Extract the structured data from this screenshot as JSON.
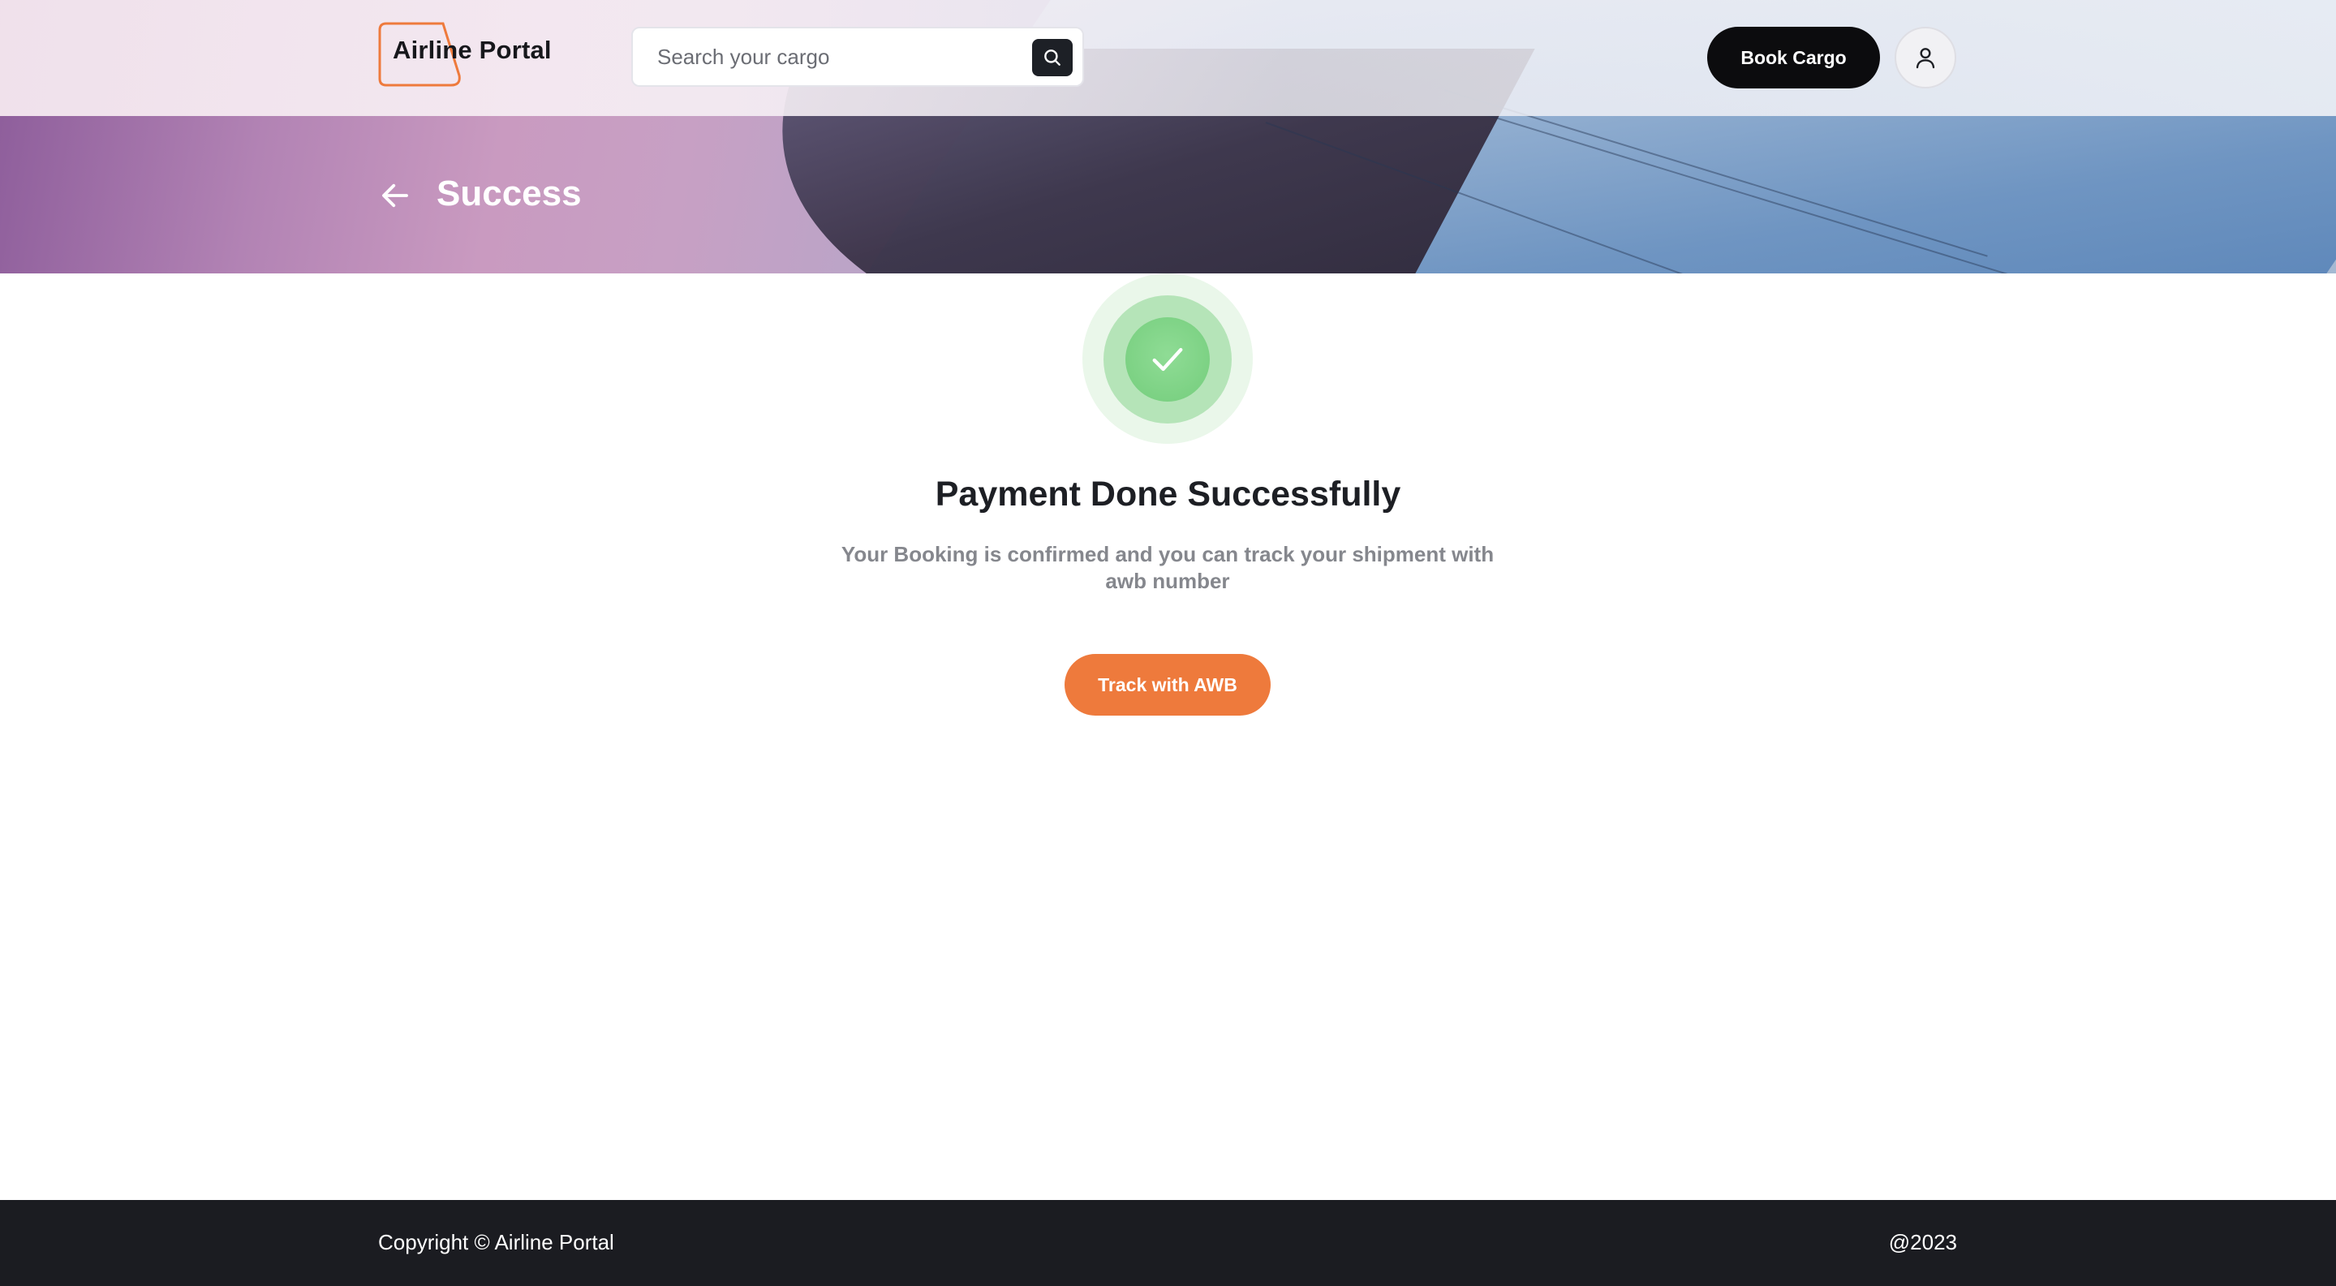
{
  "header": {
    "logo_text": "Airline Portal",
    "search": {
      "placeholder": "Search your cargo",
      "value": ""
    },
    "book_button_label": "Book Cargo"
  },
  "banner": {
    "title": "Success"
  },
  "success": {
    "title": "Payment Done Successfully",
    "description": "Your Booking is confirmed and you can track your shipment with awb number",
    "track_button_label": "Track with AWB"
  },
  "footer": {
    "copyright": "Copyright © Airline Portal",
    "year": "@2023"
  },
  "colors": {
    "accent": "#ee7a3c",
    "primary_dark": "#0c0c0e",
    "success_green": "#74cd7c",
    "footer_bg": "#1b1c21"
  },
  "icons": {
    "search": "search-icon",
    "user": "user-icon",
    "back": "arrow-left-icon",
    "check": "check-icon"
  }
}
